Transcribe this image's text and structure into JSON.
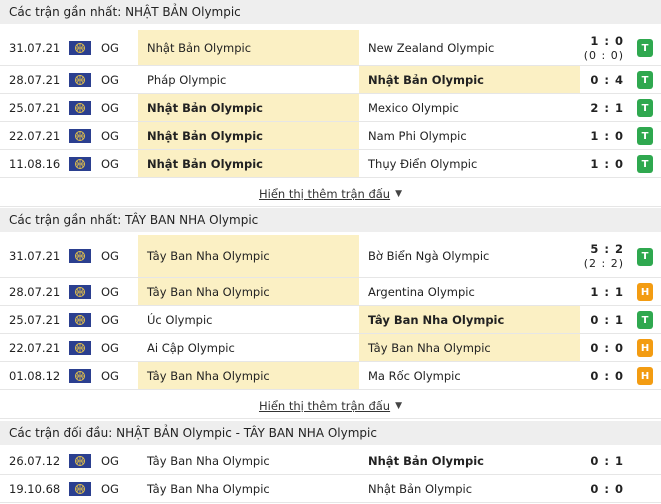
{
  "sections": [
    {
      "title": "Các trận gần nhất: NHẬT BẢN Olympic",
      "matches": [
        {
          "date": "31.07.21",
          "league": "OG",
          "home": "Nhật Bản Olympic",
          "away": "New Zealand Olympic",
          "score": "1 : 0",
          "sub_score": "(0 : 0)",
          "result": "T",
          "highlight": "home",
          "bold": ""
        },
        {
          "date": "28.07.21",
          "league": "OG",
          "home": "Pháp Olympic",
          "away": "Nhật Bản Olympic",
          "score": "0 : 4",
          "sub_score": "",
          "result": "T",
          "highlight": "away",
          "bold": "away"
        },
        {
          "date": "25.07.21",
          "league": "OG",
          "home": "Nhật Bản Olympic",
          "away": "Mexico Olympic",
          "score": "2 : 1",
          "sub_score": "",
          "result": "T",
          "highlight": "home",
          "bold": "home"
        },
        {
          "date": "22.07.21",
          "league": "OG",
          "home": "Nhật Bản Olympic",
          "away": "Nam Phi Olympic",
          "score": "1 : 0",
          "sub_score": "",
          "result": "T",
          "highlight": "home",
          "bold": "home"
        },
        {
          "date": "11.08.16",
          "league": "OG",
          "home": "Nhật Bản Olympic",
          "away": "Thụy Điển Olympic",
          "score": "1 : 0",
          "sub_score": "",
          "result": "T",
          "highlight": "home",
          "bold": "home"
        }
      ],
      "more": "Hiển thị thêm trận đấu"
    },
    {
      "title": "Các trận gần nhất: TÂY BAN NHA Olympic",
      "matches": [
        {
          "date": "31.07.21",
          "league": "OG",
          "home": "Tây Ban Nha Olympic",
          "away": "Bờ Biển Ngà Olympic",
          "score": "5 : 2",
          "sub_score": "(2 : 2)",
          "result": "T",
          "highlight": "home",
          "bold": ""
        },
        {
          "date": "28.07.21",
          "league": "OG",
          "home": "Tây Ban Nha Olympic",
          "away": "Argentina Olympic",
          "score": "1 : 1",
          "sub_score": "",
          "result": "H",
          "highlight": "home",
          "bold": ""
        },
        {
          "date": "25.07.21",
          "league": "OG",
          "home": "Úc Olympic",
          "away": "Tây Ban Nha Olympic",
          "score": "0 : 1",
          "sub_score": "",
          "result": "T",
          "highlight": "away",
          "bold": "away"
        },
        {
          "date": "22.07.21",
          "league": "OG",
          "home": "Ai Cập Olympic",
          "away": "Tây Ban Nha Olympic",
          "score": "0 : 0",
          "sub_score": "",
          "result": "H",
          "highlight": "away",
          "bold": ""
        },
        {
          "date": "01.08.12",
          "league": "OG",
          "home": "Tây Ban Nha Olympic",
          "away": "Ma Rốc Olympic",
          "score": "0 : 0",
          "sub_score": "",
          "result": "H",
          "highlight": "home",
          "bold": ""
        }
      ],
      "more": "Hiển thị thêm trận đấu"
    },
    {
      "title": "Các trận đối đầu: NHẬT BẢN Olympic - TÂY BAN NHA Olympic",
      "matches": [
        {
          "date": "26.07.12",
          "league": "OG",
          "home": "Tây Ban Nha Olympic",
          "away": "Nhật Bản Olympic",
          "score": "0 : 1",
          "sub_score": "",
          "result": "",
          "highlight": "",
          "bold": "away"
        },
        {
          "date": "19.10.68",
          "league": "OG",
          "home": "Tây Ban Nha Olympic",
          "away": "Nhật Bản Olympic",
          "score": "0 : 0",
          "sub_score": "",
          "result": "",
          "highlight": "",
          "bold": ""
        }
      ],
      "more": ""
    }
  ],
  "colors": {
    "win": "#2fa84f",
    "draw": "#f39c12",
    "highlight": "#fbf0c4",
    "header_bg": "#eeeeee"
  },
  "icons": {
    "league_flag": "olympic-flag-icon",
    "caret": "caret-down-icon"
  }
}
